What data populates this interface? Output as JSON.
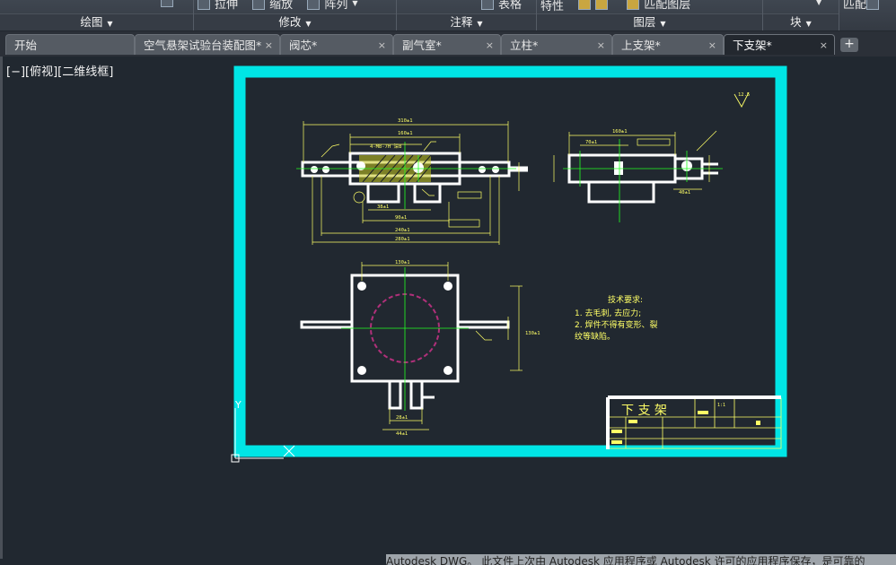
{
  "ribbon": {
    "panels": [
      {
        "title": "绘图",
        "tools": []
      },
      {
        "title": "修改",
        "tools": [
          "拉伸",
          "缩放",
          "阵列"
        ]
      },
      {
        "title": "注释",
        "tools": [
          "表格"
        ]
      },
      {
        "title": "图层",
        "tools": [
          "特性",
          "匹配图层"
        ]
      },
      {
        "title": "块",
        "tools": []
      },
      {
        "title": "",
        "tools": [
          "匹配"
        ]
      }
    ]
  },
  "tabs": [
    {
      "label": "开始",
      "closable": false,
      "active": false
    },
    {
      "label": "空气悬架试验台装配图*",
      "closable": true,
      "active": false
    },
    {
      "label": "阀芯*",
      "closable": true,
      "active": false
    },
    {
      "label": "副气室*",
      "closable": true,
      "active": false
    },
    {
      "label": "立柱*",
      "closable": true,
      "active": false
    },
    {
      "label": "上支架*",
      "closable": true,
      "active": false
    },
    {
      "label": "下支架*",
      "closable": true,
      "active": true
    }
  ],
  "tab_add": "+",
  "tab_close": "×",
  "viewport": {
    "label": "[−][俯视][二维线框]"
  },
  "drawing": {
    "frame_color": "#00e5e5",
    "line_color": "#ffffff",
    "dim_color": "#ffff66",
    "center_color": "#22ff22",
    "hidden_color": "#b0307a",
    "tech_title": "技术要求:",
    "tech_items": [
      "1.  去毛刺, 去应力;",
      "2.  焊件不得有变形、裂",
      "     纹等缺陷。"
    ],
    "title_block_name": "下 支 架",
    "ucs_y": "Y",
    "dims": {
      "front_top_1": "310±1",
      "front_top_2": "160±1",
      "front_hole": "4-M8-7H 深8",
      "front_b1": "38±1",
      "front_b2": "90±1",
      "front_b3": "240±1",
      "front_b4": "280±1",
      "side_top": "160±1",
      "side_left": "70±1",
      "side_right": "40±1",
      "plan_top": "130±1",
      "plan_right": "130±1",
      "plan_b1": "28±1",
      "plan_b2": "44±1",
      "roughness": "12.5"
    },
    "title_block_scale": "1:1"
  },
  "statusbar": {
    "text": "Autodesk DWG。 此文件上次由 Autodesk 应用程序或 Autodesk 许可的应用程序保存，是可靠的"
  }
}
